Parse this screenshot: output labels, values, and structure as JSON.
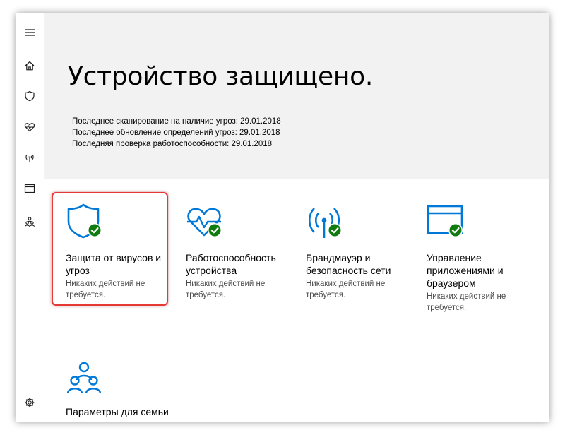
{
  "colors": {
    "accent": "#0078d7",
    "success": "#107c10",
    "hero_bg": "#f2f2f2",
    "highlight": "#e53935"
  },
  "sidebar": {
    "items": [
      {
        "name": "menu",
        "icon": "hamburger-menu-icon"
      },
      {
        "name": "home",
        "icon": "home-icon"
      },
      {
        "name": "virus-protection",
        "icon": "shield-icon"
      },
      {
        "name": "device-health",
        "icon": "heart-pulse-icon"
      },
      {
        "name": "firewall",
        "icon": "antenna-icon"
      },
      {
        "name": "app-browser",
        "icon": "browser-window-icon"
      },
      {
        "name": "family",
        "icon": "family-icon"
      },
      {
        "name": "settings",
        "icon": "gear-icon"
      }
    ]
  },
  "hero": {
    "title": "Устройство защищено.",
    "lines": [
      "Последнее сканирование на наличие угроз: 29.01.2018",
      "Последнее обновление определений угроз: 29.01.2018",
      "Последняя проверка работоспособности: 29.01.2018"
    ]
  },
  "tiles": [
    {
      "title": "Защита от вирусов и угроз",
      "subtitle": "Никаких действий не требуется.",
      "icon": "shield-check-icon",
      "selected": true
    },
    {
      "title": "Работоспособность устройства",
      "subtitle": "Никаких действий не требуется.",
      "icon": "heart-pulse-check-icon"
    },
    {
      "title": "Брандмауэр и безопасность сети",
      "subtitle": "Никаких действий не требуется.",
      "icon": "antenna-check-icon"
    },
    {
      "title": "Управление приложениями и браузером",
      "subtitle": "Никаких действий не требуется.",
      "icon": "browser-window-check-icon"
    },
    {
      "title": "Параметры для семьи",
      "icon": "family-icon"
    }
  ]
}
